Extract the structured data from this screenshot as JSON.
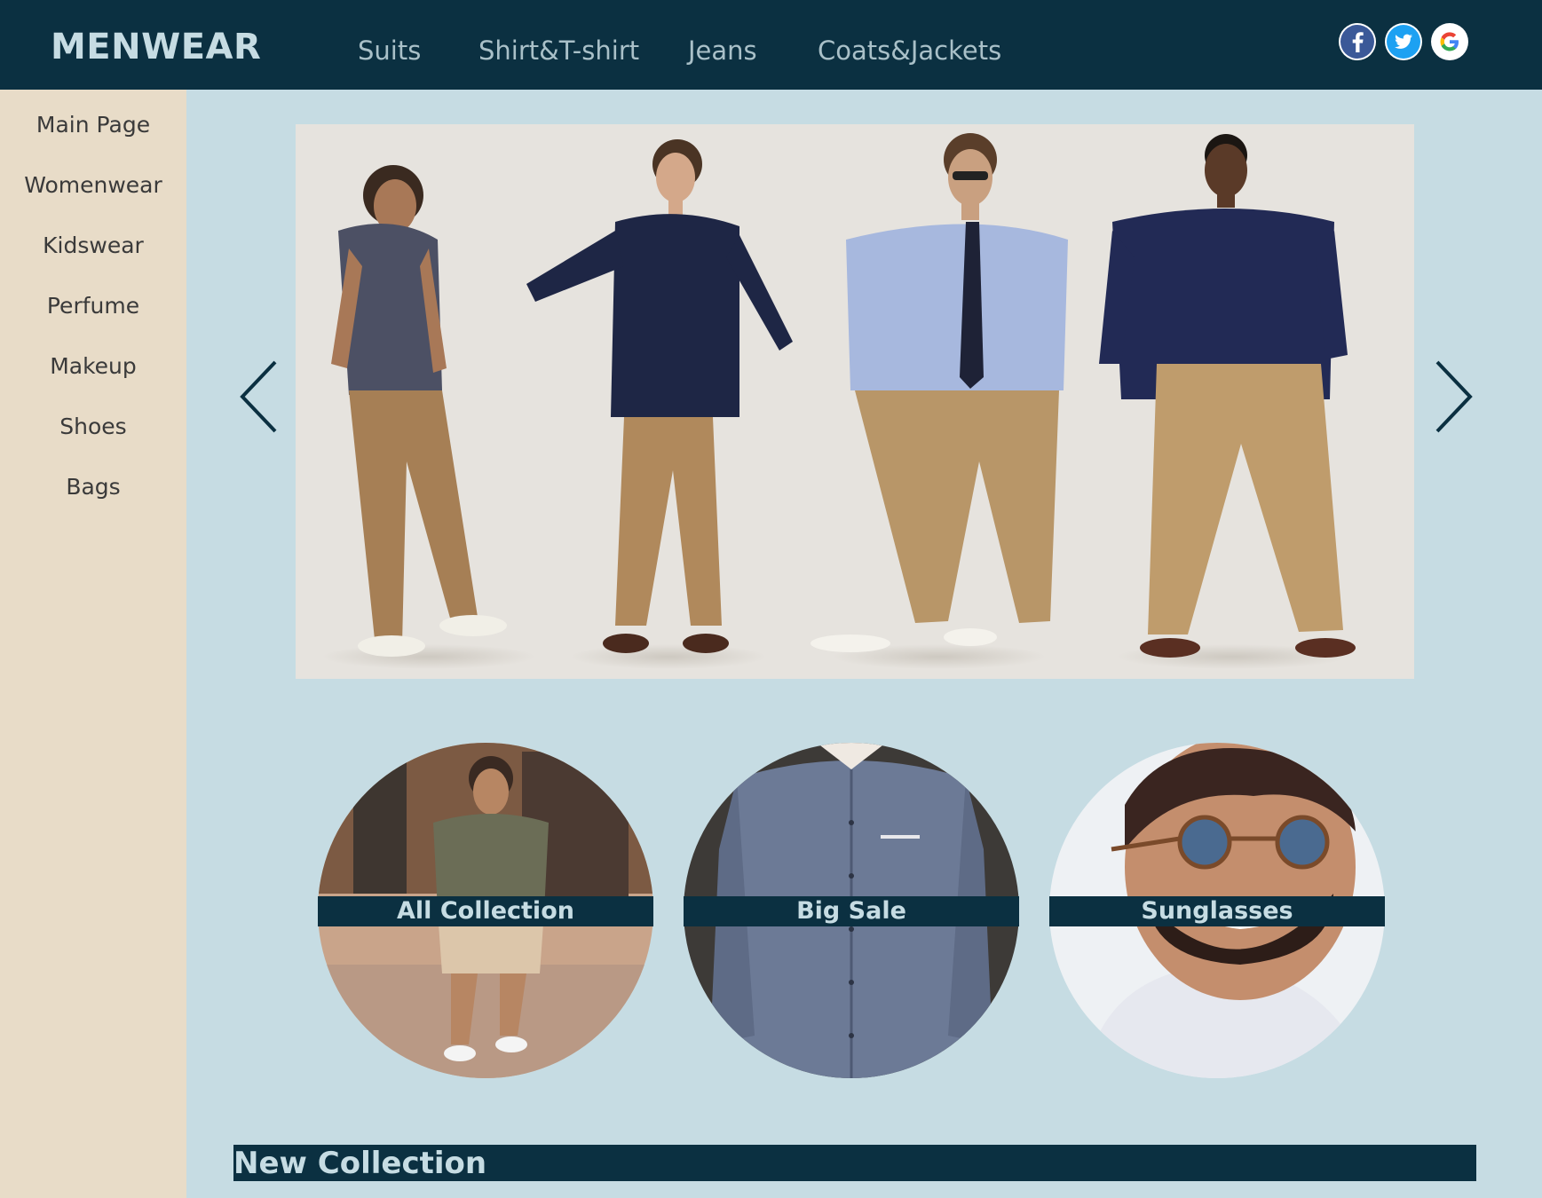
{
  "header": {
    "logo": "MENWEAR",
    "nav": [
      "Suits",
      "Shirt&T-shirt",
      "Jeans",
      "Coats&Jackets"
    ],
    "social": [
      "facebook-icon",
      "twitter-icon",
      "google-icon"
    ]
  },
  "sidebar": {
    "items": [
      "Main Page",
      "Womenwear",
      "Kidswear",
      "Perfume",
      "Makeup",
      "Shoes",
      "Bags"
    ]
  },
  "carousel": {
    "prev": "chevron-left-icon",
    "next": "chevron-right-icon"
  },
  "categories": [
    "All Collection",
    "Big Sale",
    "Sunglasses"
  ],
  "section": {
    "title": "New Collection"
  },
  "colors": {
    "header": "#0b3041",
    "sidebar": "#e8dcc8",
    "page": "#c6dce3",
    "label_text": "#c6dce3"
  }
}
